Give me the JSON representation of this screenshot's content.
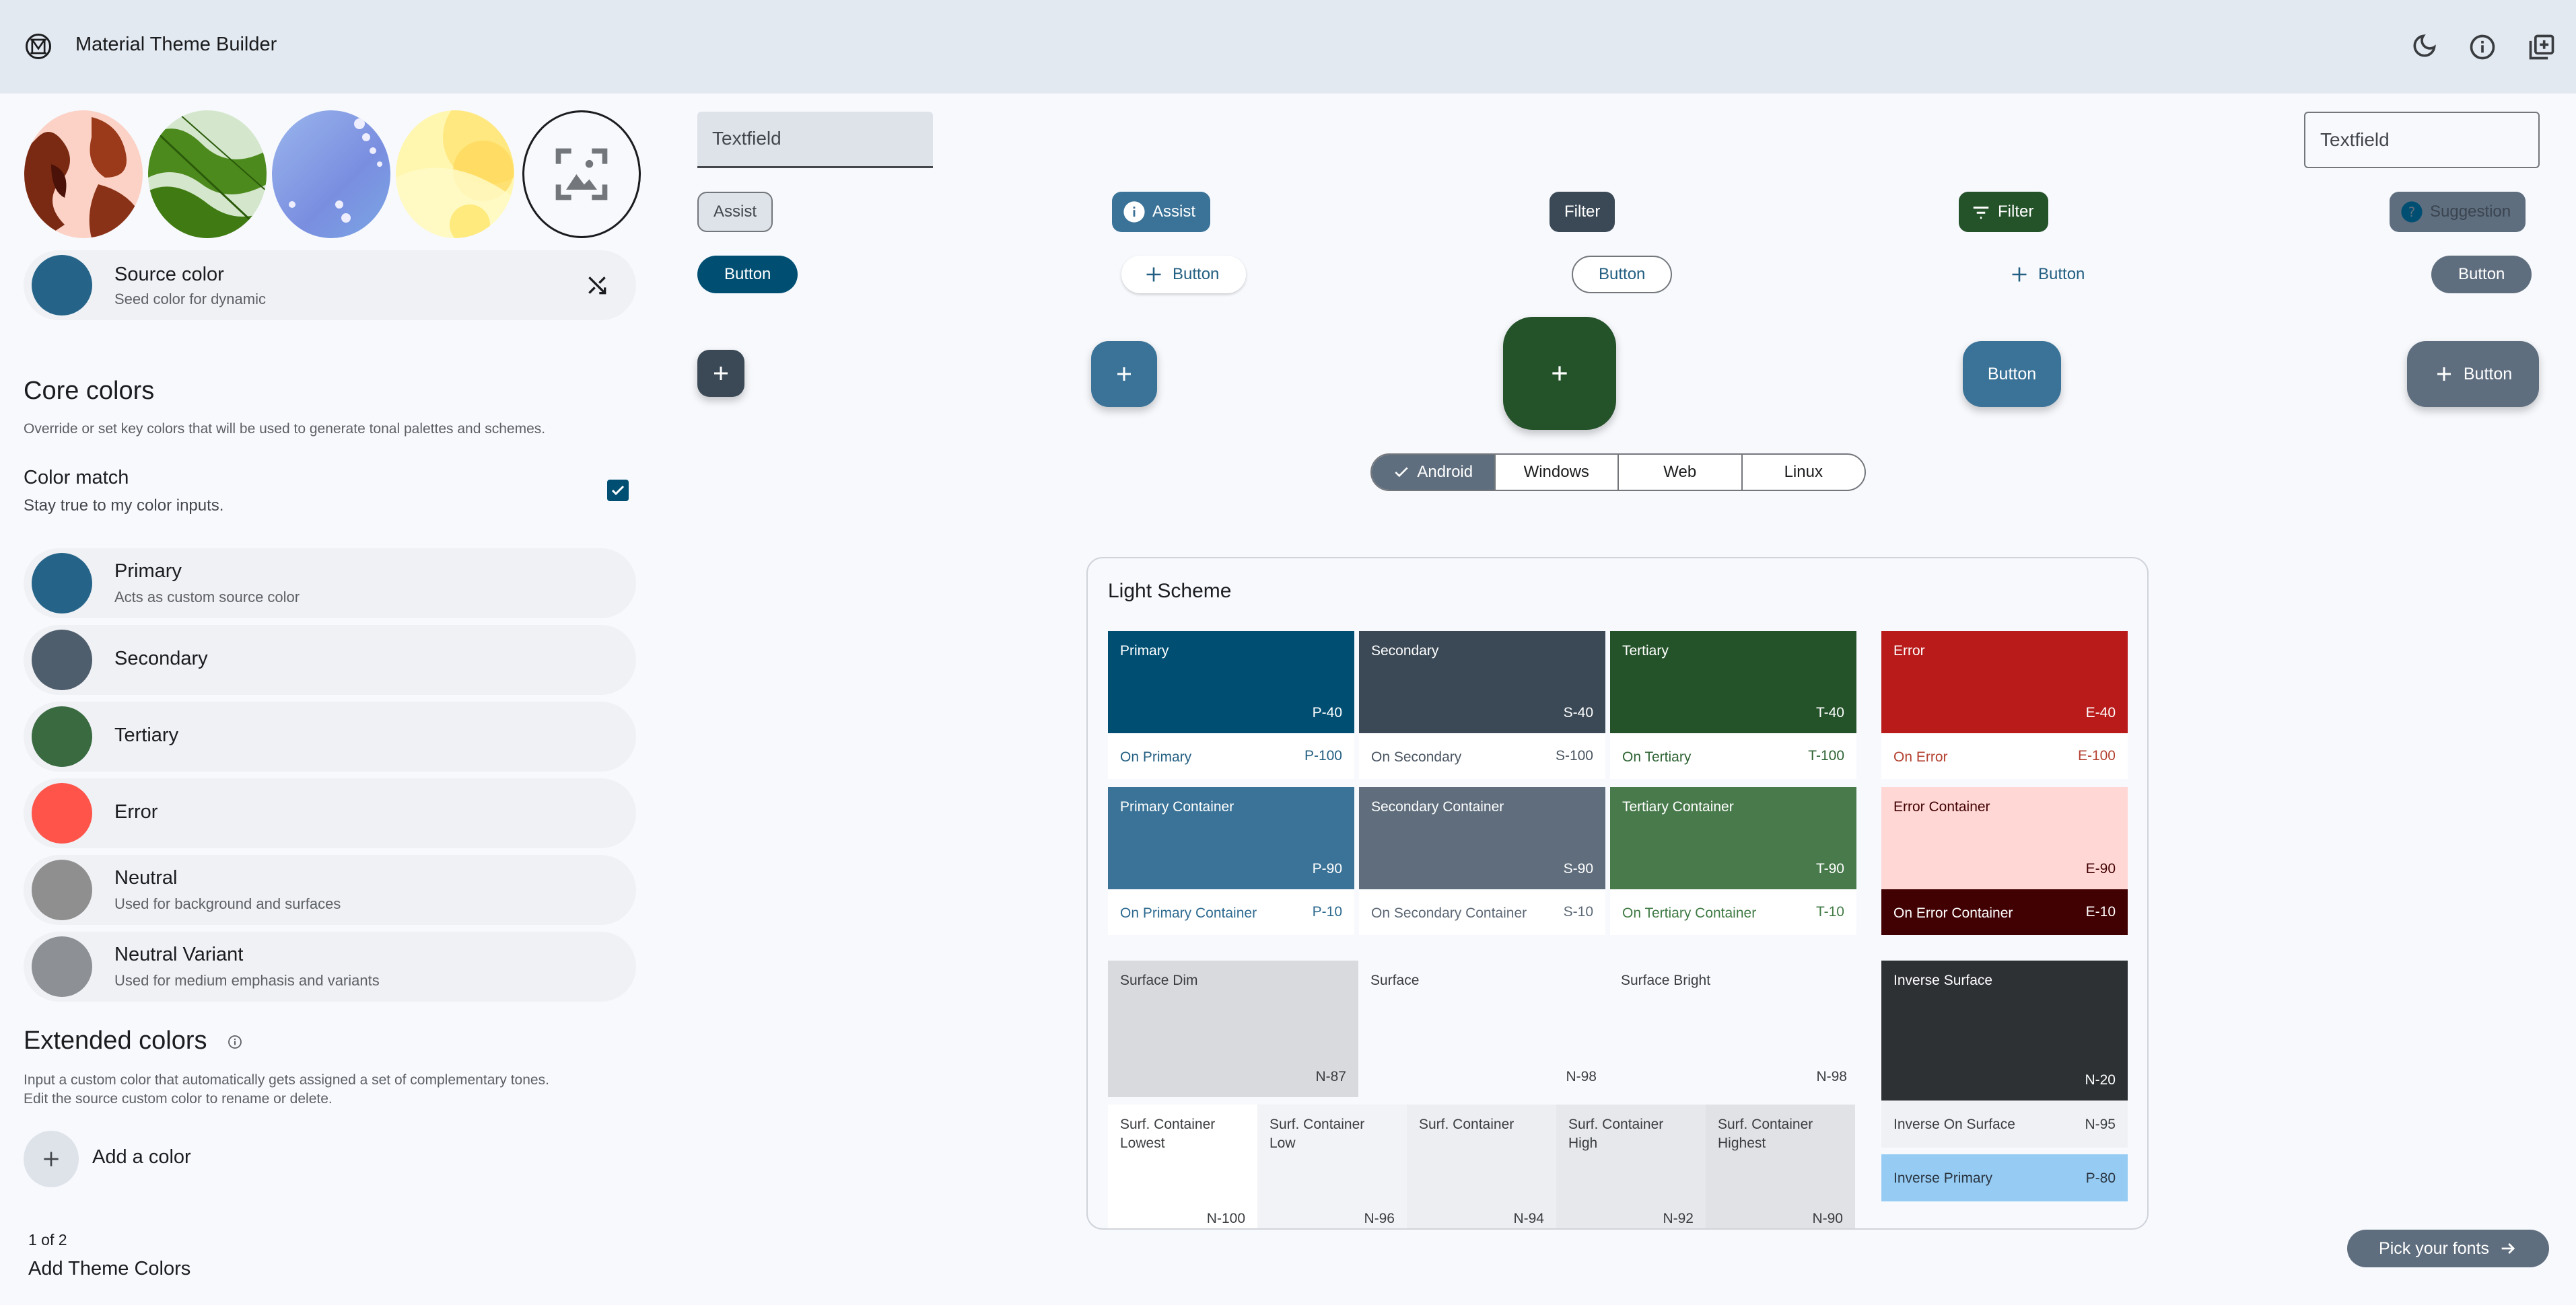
{
  "app": {
    "title": "Material Theme Builder",
    "header_icons": [
      "dark-mode-moon-icon",
      "info-icon",
      "add-to-library-icon"
    ]
  },
  "left_panel": {
    "thumbnails": [
      {
        "name": "red-leaves-wallpaper",
        "bg": "#fcd2c6"
      },
      {
        "name": "green-leaf-wallpaper",
        "bg": "#d4e7cc"
      },
      {
        "name": "blue-flowers-wallpaper",
        "bg": "#8aa7e6"
      },
      {
        "name": "yellow-drop-wallpaper",
        "bg": "#fff3a5"
      },
      {
        "name": "upload-image",
        "icon": "add-photo-icon"
      }
    ],
    "source_color": {
      "title": "Source color",
      "subtitle": "Seed color for dynamic",
      "color": "#256488",
      "action_icon": "shuffle-icon"
    },
    "core_colors": {
      "title": "Core colors",
      "description": "Override or set key colors that will be used to generate tonal palettes and schemes.",
      "color_match": {
        "title": "Color match",
        "subtitle": "Stay true to my color inputs.",
        "checked": true
      },
      "items": [
        {
          "title": "Primary",
          "subtitle": "Acts as custom source color",
          "color": "#256488"
        },
        {
          "title": "Secondary",
          "subtitle": "",
          "color": "#4f5e6d"
        },
        {
          "title": "Tertiary",
          "subtitle": "",
          "color": "#396a40"
        },
        {
          "title": "Error",
          "subtitle": "",
          "color": "#ff5449"
        },
        {
          "title": "Neutral",
          "subtitle": "Used for background and surfaces",
          "color": "#8f8f8f"
        },
        {
          "title": "Neutral Variant",
          "subtitle": "Used for medium emphasis and variants",
          "color": "#8d9094"
        }
      ]
    },
    "extended_colors": {
      "title": "Extended colors",
      "description_line1": "Input a custom color that automatically gets assigned a set of complementary tones.",
      "description_line2": "Edit the source custom color to rename or delete.",
      "add_label": "Add a color"
    },
    "step": {
      "counter": "1 of 2",
      "title": "Add Theme Colors"
    }
  },
  "components": {
    "textfield_filled": "Textfield",
    "textfield_outlined": "Textfield",
    "chips": [
      {
        "label": "Assist",
        "variant": "outlined"
      },
      {
        "label": "Assist",
        "variant": "elevated-icon"
      },
      {
        "label": "Filter",
        "variant": "filled"
      },
      {
        "label": "Filter",
        "variant": "filter-icon"
      },
      {
        "label": "Suggestion",
        "variant": "disabled"
      }
    ],
    "buttons": [
      {
        "label": "Button",
        "variant": "filled"
      },
      {
        "label": "Button",
        "variant": "elevated-icon"
      },
      {
        "label": "Button",
        "variant": "outlined"
      },
      {
        "label": "Button",
        "variant": "text-icon"
      },
      {
        "label": "Button",
        "variant": "tonal"
      }
    ],
    "fabs": {
      "small_icon": "plus-icon",
      "medium_icon": "plus-icon",
      "large_icon": "plus-icon",
      "extended_label": "Button",
      "extended_icon_label": "Button"
    },
    "segmented": {
      "options": [
        "Android",
        "Windows",
        "Web",
        "Linux"
      ],
      "selected": "Android"
    }
  },
  "light_scheme": {
    "title": "Light Scheme",
    "main": [
      {
        "label": "Primary",
        "tone": "P-40",
        "bg": "#004f73",
        "fg": "#ffffff",
        "on_label": "On Primary",
        "on_tone": "P-100",
        "on_bg": "#ffffff",
        "on_fg": "#235f82"
      },
      {
        "label": "Secondary",
        "tone": "S-40",
        "bg": "#3b4956",
        "fg": "#ffffff",
        "on_label": "On Secondary",
        "on_tone": "S-100",
        "on_bg": "#ffffff",
        "on_fg": "#4a5561"
      },
      {
        "label": "Tertiary",
        "tone": "T-40",
        "bg": "#245229",
        "fg": "#ffffff",
        "on_label": "On Tertiary",
        "on_tone": "T-100",
        "on_bg": "#ffffff",
        "on_fg": "#2d6333"
      }
    ],
    "containers": [
      {
        "label": "Primary Container",
        "tone": "P-90",
        "bg": "#3a7397",
        "fg": "#ffffff",
        "on_label": "On Primary Container",
        "on_tone": "P-10",
        "on_bg": "#ffffff",
        "on_fg": "#2d6a8f"
      },
      {
        "label": "Secondary Container",
        "tone": "S-90",
        "bg": "#5f6d7c",
        "fg": "#ffffff",
        "on_label": "On Secondary Container",
        "on_tone": "S-10",
        "on_bg": "#ffffff",
        "on_fg": "#5c6875"
      },
      {
        "label": "Tertiary Container",
        "tone": "T-90",
        "bg": "#487a4b",
        "fg": "#ffffff",
        "on_label": "On Tertiary Container",
        "on_tone": "T-10",
        "on_bg": "#ffffff",
        "on_fg": "#3f7a44"
      }
    ],
    "error": {
      "label": "Error",
      "tone": "E-40",
      "bg": "#b91a1a",
      "fg": "#ffffff",
      "on_label": "On Error",
      "on_tone": "E-100",
      "on_bg": "#ffffff",
      "on_fg": "#b3402f",
      "container_label": "Error Container",
      "container_tone": "E-90",
      "container_bg": "#ffd8d5",
      "container_fg": "#410002",
      "on_container_label": "On Error Container",
      "on_container_tone": "E-10",
      "on_container_bg": "#410002",
      "on_container_fg": "#ffffff"
    },
    "surfaces": [
      {
        "label": "Surface Dim",
        "tone": "N-87",
        "bg": "#d9dadd"
      },
      {
        "label": "Surface",
        "tone": "N-98",
        "bg": "#f7f9fd"
      },
      {
        "label": "Surface Bright",
        "tone": "N-98",
        "bg": "#f7f9fd"
      }
    ],
    "surface_containers": [
      {
        "label_line1": "Surf. Container",
        "label_line2": "Lowest",
        "tone": "N-100",
        "bg": "#ffffff"
      },
      {
        "label_line1": "Surf. Container",
        "label_line2": "Low",
        "tone": "N-96",
        "bg": "#f2f3f7"
      },
      {
        "label_line1": "Surf. Container",
        "label_line2": "",
        "tone": "N-94",
        "bg": "#eceef1"
      },
      {
        "label_line1": "Surf. Container",
        "label_line2": "High",
        "tone": "N-92",
        "bg": "#e6e8eb"
      },
      {
        "label_line1": "Surf. Container",
        "label_line2": "Highest",
        "tone": "N-90",
        "bg": "#e1e2e5"
      }
    ],
    "inverse": [
      {
        "label": "Inverse Surface",
        "tone": "N-20",
        "bg": "#2d3134",
        "fg": "#ffffff"
      },
      {
        "label": "Inverse On Surface",
        "tone": "N-95",
        "bg": "#eff1f4",
        "fg": "#3a3d40"
      },
      {
        "label": "Inverse Primary",
        "tone": "P-80",
        "bg": "#96ccf3",
        "fg": "#2a3440"
      }
    ]
  },
  "footer": {
    "next_label": "Pick your fonts",
    "next_icon": "arrow-right-icon"
  }
}
